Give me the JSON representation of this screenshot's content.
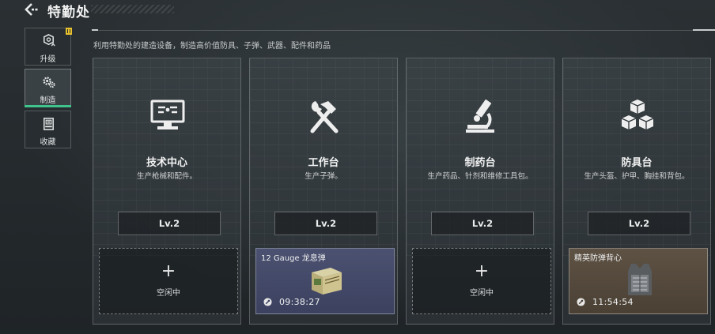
{
  "header": {
    "title": "特勤处",
    "back_icon": "back-arrow-icon"
  },
  "subtitle": "利用特勤处的建造设备，制造高价值防具、子弹、武器、配件和药品",
  "sidebar": {
    "items": [
      {
        "label": "升级",
        "icon": "upgrade-icon",
        "active": false,
        "has_notification": true
      },
      {
        "label": "制造",
        "icon": "gears-icon",
        "active": true,
        "has_notification": false
      },
      {
        "label": "收藏",
        "icon": "collection-icon",
        "active": false,
        "has_notification": false
      }
    ]
  },
  "colors": {
    "accent_green": "#3ec48c",
    "notification_yellow": "#e8c12e",
    "slot_blue": "#4b5170",
    "slot_brown": "#5e5244"
  },
  "facilities": [
    {
      "name": "技术中心",
      "desc": "生产枪械和配件。",
      "level": "Lv.2",
      "icon": "monitor-icon",
      "slot": {
        "state": "idle",
        "plus": "+",
        "label": "空闲中"
      }
    },
    {
      "name": "工作台",
      "desc": "生产子弹。",
      "level": "Lv.2",
      "icon": "hammer-wrench-icon",
      "slot": {
        "state": "busy",
        "item": "12 Gauge 龙息弹",
        "timer": "09:38:27",
        "item_icon": "ammo-box-icon",
        "timer_icon": "wrench-icon"
      }
    },
    {
      "name": "制药台",
      "desc": "生产药品、针剂和维修工具包。",
      "level": "Lv.2",
      "icon": "microscope-icon",
      "slot": {
        "state": "idle",
        "plus": "+",
        "label": "空闲中"
      }
    },
    {
      "name": "防具台",
      "desc": "生产头盔、护甲、胸挂和背包。",
      "level": "Lv.2",
      "icon": "cubes-icon",
      "slot": {
        "state": "busy",
        "item": "精英防弹背心",
        "timer": "11:54:54",
        "item_icon": "armor-vest-icon",
        "timer_icon": "wrench-icon"
      }
    }
  ]
}
